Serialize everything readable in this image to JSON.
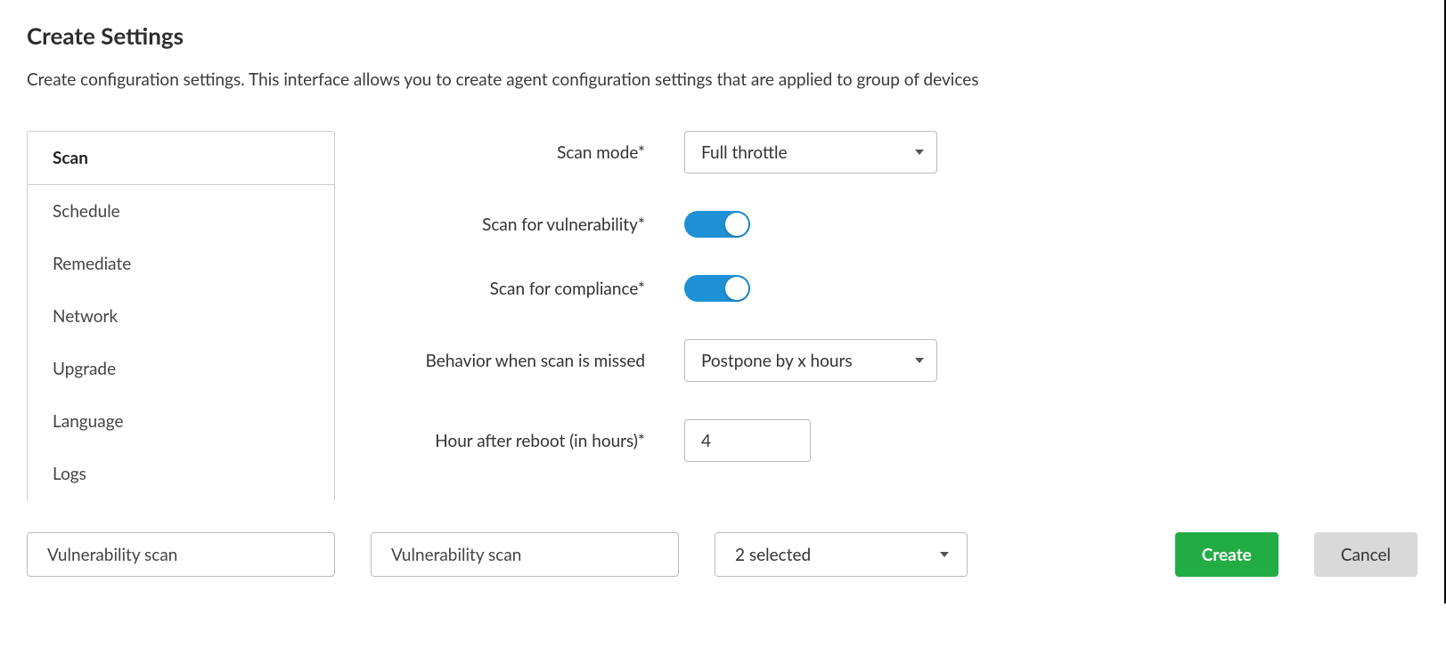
{
  "page": {
    "title": "Create Settings",
    "description": "Create configuration settings. This interface allows you to create agent configuration settings that are applied to group of devices"
  },
  "sidebar": {
    "items": [
      {
        "label": "Scan",
        "active": true
      },
      {
        "label": "Schedule",
        "active": false
      },
      {
        "label": "Remediate",
        "active": false
      },
      {
        "label": "Network",
        "active": false
      },
      {
        "label": "Upgrade",
        "active": false
      },
      {
        "label": "Language",
        "active": false
      },
      {
        "label": "Logs",
        "active": false
      }
    ]
  },
  "form": {
    "scan_mode": {
      "label": "Scan mode*",
      "value": "Full throttle"
    },
    "scan_vulnerability": {
      "label": "Scan for vulnerability*",
      "on": true
    },
    "scan_compliance": {
      "label": "Scan for compliance*",
      "on": true
    },
    "missed_behavior": {
      "label": "Behavior when scan is missed",
      "value": "Postpone by x hours"
    },
    "hours_after_reboot": {
      "label": "Hour after reboot (in hours)*",
      "value": "4"
    }
  },
  "footer": {
    "name1": "Vulnerability scan",
    "name2": "Vulnerability scan",
    "multi_select": "2 selected",
    "create_label": "Create",
    "cancel_label": "Cancel"
  }
}
